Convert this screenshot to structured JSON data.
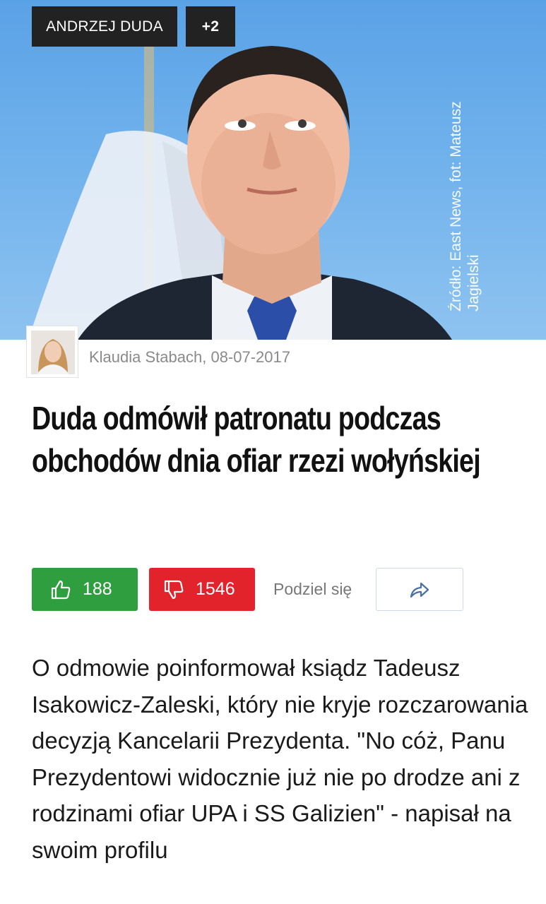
{
  "tags": {
    "primary": "ANDRZEJ DUDA",
    "more": "+2"
  },
  "photo_credit": {
    "line1": "Źródło: East News, fot: Mateusz",
    "line2": "Jagielski"
  },
  "article": {
    "byline": "Klaudia Stabach, 08-07-2017",
    "title": "Duda odmówił patronatu podczas obchodów dnia ofiar rzezi wołyńskiej",
    "body": "O odmowie poinformował ksiądz Tadeusz Isakowicz-Zaleski, który nie kryje rozczarowania decyzją Kancelarii Prezydenta. \"No cóż, Panu Prezydentowi widocznie już nie po drodze ani z rodzinami ofiar UPA i SS Galizien\" - napisał na swoim profilu"
  },
  "reactions": {
    "likes": "188",
    "dislikes": "1546",
    "share_label": "Podziel się"
  },
  "icons": {
    "like": "thumbs-up-icon",
    "dislike": "thumbs-down-icon",
    "share": "share-arrow-icon"
  },
  "colors": {
    "like": "#2e9e3f",
    "dislike": "#e3232b",
    "tag_bg": "#222222"
  }
}
